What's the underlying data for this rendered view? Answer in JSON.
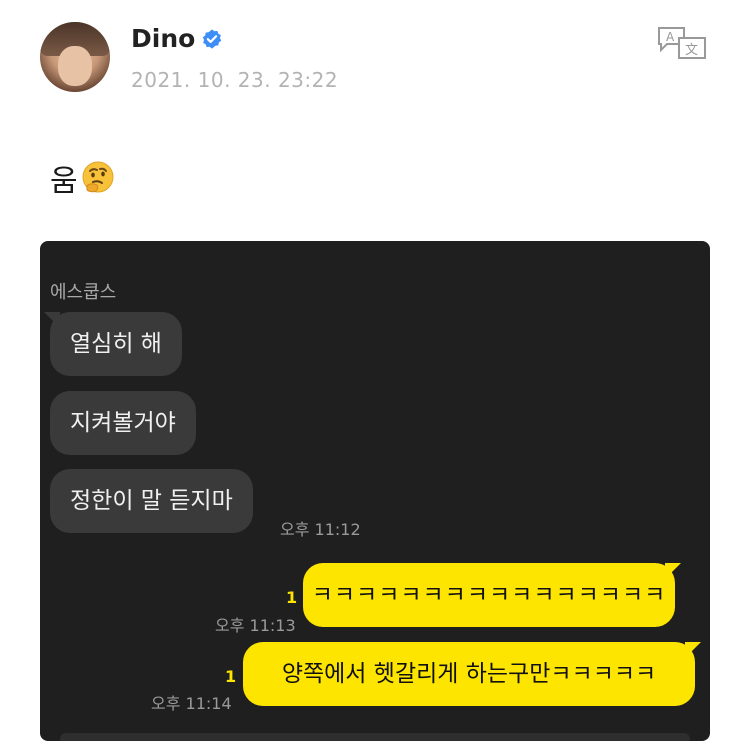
{
  "post": {
    "author": "Dino",
    "verified": true,
    "timestamp": "2021. 10. 23. 23:22",
    "text": "움",
    "emoji": "thinking-face-icon"
  },
  "chat": {
    "sender_name": "에스쿱스",
    "incoming": [
      {
        "text": "열심히 해"
      },
      {
        "text": "지켜볼거야"
      },
      {
        "text": "정한이 말 듣지마"
      }
    ],
    "incoming_time": "오후 11:12",
    "outgoing": [
      {
        "text": "ㅋㅋㅋㅋㅋㅋㅋㅋㅋㅋㅋㅋㅋㅋㅋㅋ",
        "unread": "1",
        "time": "오후 11:13"
      },
      {
        "text": "양쪽에서 헷갈리게 하는구만ㅋㅋㅋㅋㅋ",
        "unread": "1",
        "time": "오후 11:14"
      }
    ]
  },
  "colors": {
    "verified_blue": "#3d8ef7",
    "chat_background": "#1f1f1f",
    "incoming_bubble": "#3a3a3a",
    "outgoing_bubble": "#fee500"
  }
}
